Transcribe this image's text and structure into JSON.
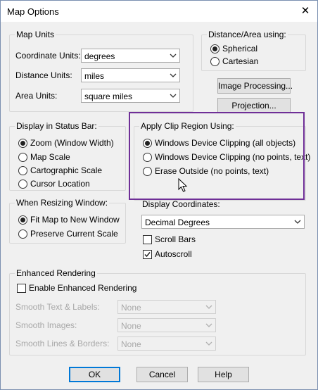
{
  "window": {
    "title": "Map Options",
    "close_glyph": "✕"
  },
  "map_units": {
    "legend": "Map Units",
    "coordinate": {
      "label": "Coordinate Units:",
      "value": "degrees"
    },
    "distance": {
      "label": "Distance Units:",
      "value": "miles"
    },
    "area": {
      "label": "Area Units:",
      "value": "square miles"
    }
  },
  "distance_area": {
    "legend": "Distance/Area using:",
    "options": [
      {
        "label": "Spherical",
        "selected": true
      },
      {
        "label": "Cartesian",
        "selected": false
      }
    ]
  },
  "buttons": {
    "image_processing": "Image Processing...",
    "projection": "Projection...",
    "ok": "OK",
    "cancel": "Cancel",
    "help": "Help"
  },
  "status_bar": {
    "legend": "Display in Status Bar:",
    "options": [
      {
        "label": "Zoom (Window Width)",
        "selected": true
      },
      {
        "label": "Map Scale",
        "selected": false
      },
      {
        "label": "Cartographic Scale",
        "selected": false
      },
      {
        "label": "Cursor Location",
        "selected": false
      }
    ]
  },
  "clip_region": {
    "legend": "Apply Clip Region Using:",
    "options": [
      {
        "label": "Windows Device Clipping (all objects)",
        "selected": true
      },
      {
        "label": "Windows Device Clipping (no points, text)",
        "selected": false
      },
      {
        "label": "Erase Outside (no points, text)",
        "selected": false
      }
    ]
  },
  "resizing": {
    "legend": "When Resizing Window:",
    "options": [
      {
        "label": "Fit Map to New Window",
        "selected": true
      },
      {
        "label": "Preserve Current Scale",
        "selected": false
      }
    ]
  },
  "display_coords": {
    "legend": "Display Coordinates:",
    "value": "Decimal Degrees",
    "scroll_bars": {
      "label": "Scroll Bars",
      "checked": false
    },
    "autoscroll": {
      "label": "Autoscroll",
      "checked": true
    }
  },
  "enhanced": {
    "legend": "Enhanced Rendering",
    "enable": {
      "label": "Enable Enhanced Rendering",
      "checked": false
    },
    "smooth_text": {
      "label": "Smooth Text & Labels:",
      "value": "None"
    },
    "smooth_images": {
      "label": "Smooth Images:",
      "value": "None"
    },
    "smooth_lines": {
      "label": "Smooth Lines & Borders:",
      "value": "None"
    }
  },
  "icons": {
    "dropdown": "chevron-down-icon",
    "close": "close-icon",
    "check": "checkmark-icon",
    "cursor": "mouse-pointer-icon"
  }
}
